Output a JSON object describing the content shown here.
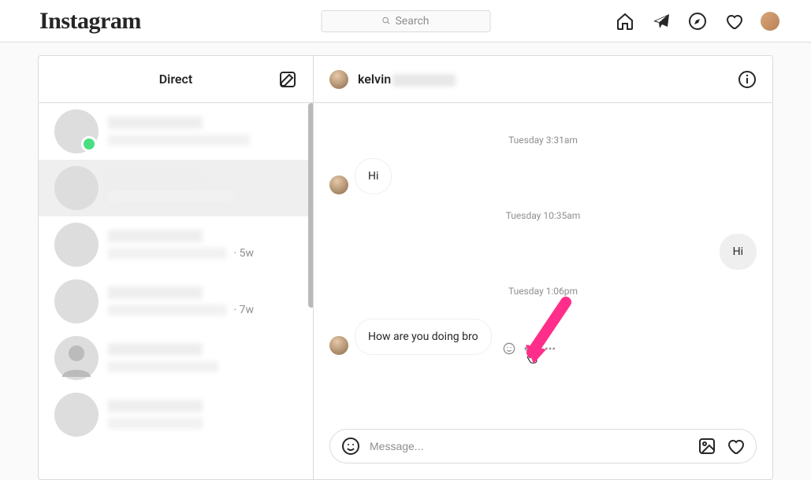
{
  "brand": "Instagram",
  "search": {
    "placeholder": "Search"
  },
  "sidebar": {
    "title": "Direct",
    "threads": [
      {
        "time": ""
      },
      {
        "time": ""
      },
      {
        "time": "5w"
      },
      {
        "time": "7w"
      },
      {
        "time": ""
      },
      {
        "time": ""
      }
    ]
  },
  "chat": {
    "username_visible_prefix": "kelvin",
    "timestamps": [
      "Tuesday 3:31am",
      "Tuesday 10:35am",
      "Tuesday 1:06pm"
    ],
    "messages": [
      {
        "from": "them",
        "text": "Hi"
      },
      {
        "from": "me",
        "text": "Hi"
      },
      {
        "from": "them",
        "text": "How are you doing bro"
      }
    ],
    "composer_placeholder": "Message..."
  }
}
